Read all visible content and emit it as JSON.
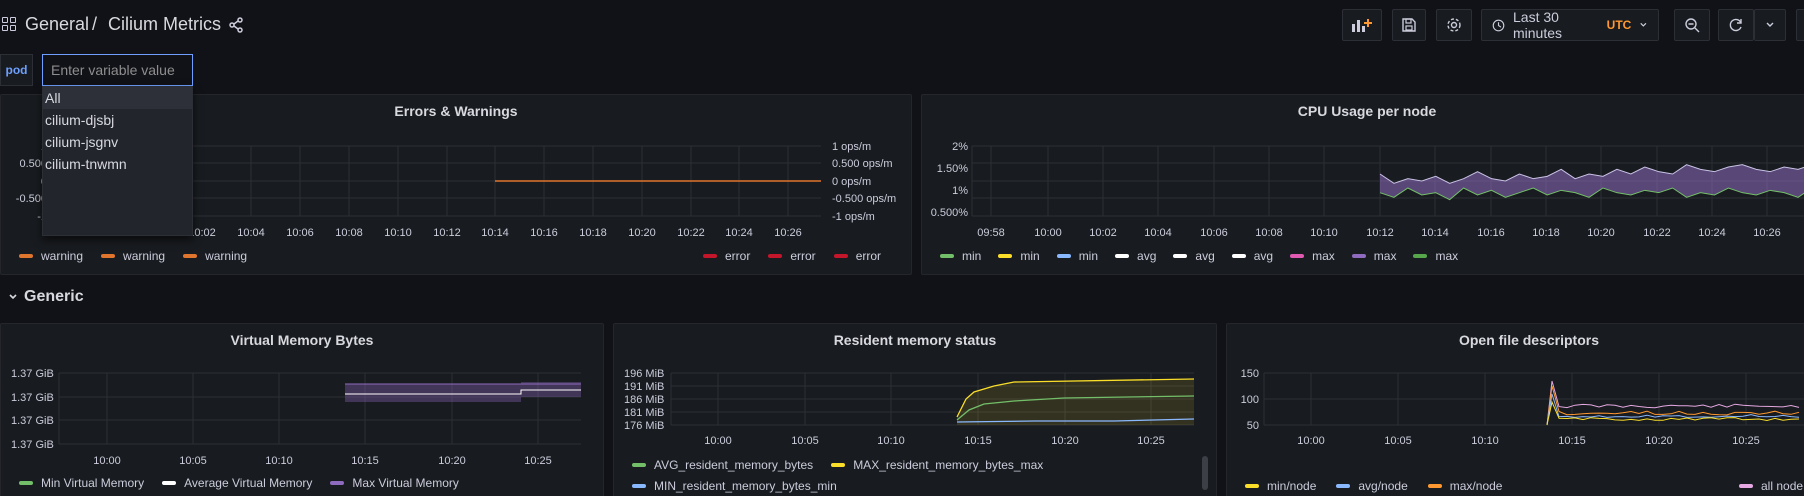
{
  "header": {
    "folder": "General",
    "separator": "/",
    "dashboard": "Cilium Metrics",
    "time_range": "Last 30 minutes",
    "timezone": "UTC"
  },
  "variables": {
    "pod_label": "pod",
    "pod_placeholder": "Enter variable value",
    "options": [
      "All",
      "cilium-djsbj",
      "cilium-jsgnv",
      "cilium-tnwmn"
    ]
  },
  "row": {
    "title": "Generic"
  },
  "colors": {
    "warning": "#e0752d",
    "error": "#c4162a",
    "min": "#73bf69",
    "min_yellow": "#fade2a",
    "min_blue": "#8ab8ff",
    "avg": "#ffffff",
    "max_pink": "#e05ab2",
    "max_purple": "#8f6bbf",
    "max_green": "#56a64b"
  },
  "panels": {
    "errors": {
      "title": "Errors & Warnings",
      "legend_left": [
        "warning",
        "warning",
        "warning"
      ],
      "legend_right": [
        "error",
        "error",
        "error"
      ],
      "chart_data": {
        "type": "line",
        "x": [
          "10:02",
          "10:04",
          "10:06",
          "10:08",
          "10:10",
          "10:12",
          "10:14",
          "10:16",
          "10:18",
          "10:20",
          "10:22",
          "10:24",
          "10:26"
        ],
        "y_left_ticks": [
          "1",
          "0.500",
          "0",
          "-0.500",
          "-1"
        ],
        "y_right_ticks": [
          "1 ops/m",
          "0.500 ops/m",
          "0 ops/m",
          "-0.500 ops/m",
          "-1 ops/m"
        ],
        "ylim": [
          -1,
          1
        ],
        "series": [
          {
            "name": "warning",
            "from": "10:14",
            "to": "10:27",
            "value": 0
          }
        ]
      }
    },
    "cpu": {
      "title": "CPU Usage per node",
      "legend": [
        "min",
        "min",
        "min",
        "avg",
        "avg",
        "avg",
        "max",
        "max",
        "max"
      ],
      "chart_data": {
        "type": "area",
        "x": [
          "09:58",
          "10:00",
          "10:02",
          "10:04",
          "10:06",
          "10:08",
          "10:10",
          "10:12",
          "10:14",
          "10:16",
          "10:18",
          "10:20",
          "10:22",
          "10:24",
          "10:26"
        ],
        "y_ticks": [
          "2%",
          "1.50%",
          "1%",
          "0.500%"
        ],
        "ylim": [
          0.5,
          2
        ],
        "series_start": "10:14",
        "min_values": [
          1.0,
          0.9,
          1.1,
          0.95,
          1.0,
          0.85,
          1.1,
          0.95,
          1.05,
          0.9,
          1.0,
          1.1,
          0.95,
          1.05,
          1.0,
          0.9,
          1.1,
          1.0,
          0.95,
          1.05,
          1.0,
          1.1,
          0.9,
          1.0,
          0.95,
          1.1,
          1.0,
          0.95,
          1.05,
          1.0,
          0.9,
          1.1
        ],
        "max_values": [
          1.4,
          1.2,
          1.3,
          1.25,
          1.35,
          1.2,
          1.3,
          1.45,
          1.3,
          1.25,
          1.4,
          1.3,
          1.35,
          1.5,
          1.3,
          1.4,
          1.35,
          1.5,
          1.4,
          1.55,
          1.45,
          1.4,
          1.6,
          1.5,
          1.45,
          1.55,
          1.6,
          1.5,
          1.45,
          1.55,
          1.5,
          1.6
        ]
      }
    },
    "vmem": {
      "title": "Virtual Memory Bytes",
      "legend": [
        "Min Virtual Memory",
        "Average Virtual Memory",
        "Max Virtual Memory"
      ],
      "chart_data": {
        "type": "area",
        "x": [
          "10:00",
          "10:05",
          "10:10",
          "10:15",
          "10:20",
          "10:25"
        ],
        "y_ticks": [
          "1.37 GiB",
          "1.37 GiB",
          "1.37 GiB",
          "1.37 GiB"
        ]
      }
    },
    "resmem": {
      "title": "Resident memory status",
      "legend": [
        "AVG_resident_memory_bytes",
        "MAX_resident_memory_bytes_max",
        "MIN_resident_memory_bytes_min"
      ],
      "chart_data": {
        "type": "area",
        "x": [
          "10:00",
          "10:05",
          "10:10",
          "10:15",
          "10:20",
          "10:25"
        ],
        "y_ticks": [
          "196 MiB",
          "191 MiB",
          "186 MiB",
          "181 MiB",
          "176 MiB"
        ],
        "ylim": [
          176,
          196
        ],
        "series": [
          {
            "name": "MAX_resident_memory_bytes_max",
            "values": [
              186,
              191,
              192,
              193,
              193.5,
              194
            ]
          },
          {
            "name": "AVG_resident_memory_bytes",
            "values": [
              181,
              184,
              185,
              186,
              186.5,
              187
            ]
          },
          {
            "name": "MIN_resident_memory_bytes_min",
            "values": [
              178,
              178,
              178,
              178,
              178,
              178.5
            ]
          }
        ]
      }
    },
    "fds": {
      "title": "Open file descriptors",
      "legend": [
        "min/node",
        "avg/node",
        "max/node",
        "all node"
      ],
      "chart_data": {
        "type": "line",
        "x": [
          "10:00",
          "10:05",
          "10:10",
          "10:15",
          "10:20",
          "10:25"
        ],
        "y_ticks": [
          "150",
          "100",
          "50"
        ],
        "ylim": [
          50,
          150
        ]
      }
    }
  }
}
